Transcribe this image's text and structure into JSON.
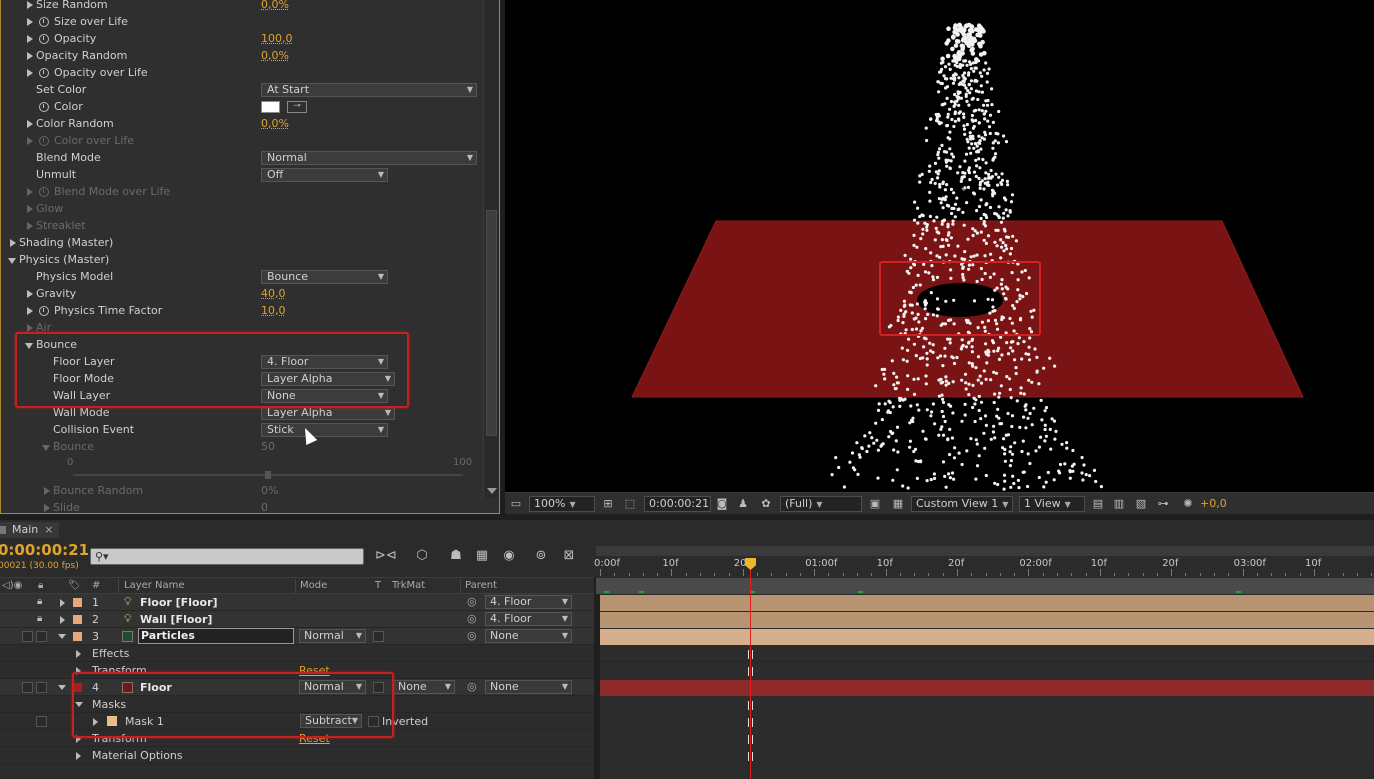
{
  "effect_controls": {
    "rows": [
      {
        "label": "Size Random",
        "value": "0,0%"
      },
      {
        "label": "Size over Life"
      },
      {
        "label": "Opacity",
        "value": "100,0"
      },
      {
        "label": "Opacity Random",
        "value": "0,0%"
      },
      {
        "label": "Opacity over Life"
      },
      {
        "label": "Set Color",
        "dropdown": "At Start"
      },
      {
        "label": "Color"
      },
      {
        "label": "Color Random",
        "value": "0,0%"
      },
      {
        "label": "Color over Life"
      },
      {
        "label": "Blend Mode",
        "dropdown": "Normal"
      },
      {
        "label": "Unmult",
        "dropdown": "Off"
      },
      {
        "label": "Blend Mode over Life"
      },
      {
        "label": "Glow"
      },
      {
        "label": "Streaklet"
      },
      {
        "label": "Shading (Master)"
      },
      {
        "label": "Physics (Master)"
      },
      {
        "label": "Physics Model",
        "dropdown": "Bounce"
      },
      {
        "label": "Gravity",
        "value": "40,0"
      },
      {
        "label": "Physics Time Factor",
        "value": "10,0"
      },
      {
        "label": "Air"
      },
      {
        "label": "Bounce"
      },
      {
        "label": "Floor Layer",
        "dropdown": "4. Floor"
      },
      {
        "label": "Floor Mode",
        "dropdown": "Layer Alpha"
      },
      {
        "label": "Wall Layer",
        "dropdown": "None"
      },
      {
        "label": "Wall Mode",
        "dropdown": "Layer Alpha"
      },
      {
        "label": "Collision Event",
        "dropdown": "Stick"
      },
      {
        "label": "Bounce",
        "value": "50"
      },
      {
        "label": "Bounce Random",
        "value": "0%"
      },
      {
        "label": "Slide",
        "value": "0"
      }
    ],
    "slider": {
      "min": "0",
      "max": "100"
    },
    "color_swatch": "#ffffff"
  },
  "viewer": {
    "zoom": "100%",
    "timecode": "0:00:00:21",
    "resolution": "(Full)",
    "view": "Custom View 1",
    "layout": "1 View",
    "exposure": "+0,0",
    "floor_color": "#7a1414"
  },
  "timeline": {
    "tab": "Main",
    "close": "×",
    "timecode": "0:00:00:21",
    "fps": "00021 (30.00 fps)",
    "search_placeholder": "⚲▾",
    "columns": {
      "num": "#",
      "layer_name": "Layer Name",
      "mode": "Mode",
      "t": "T",
      "trkmat": "TrkMat",
      "parent": "Parent"
    },
    "layers": [
      {
        "num": "1",
        "name": "Floor [Floor]",
        "parent": "4. Floor",
        "color": "#e8a87c"
      },
      {
        "num": "2",
        "name": "Wall [Floor]",
        "parent": "4. Floor",
        "color": "#e8a87c"
      },
      {
        "num": "3",
        "name": "Particles",
        "mode": "Normal",
        "parent": "None",
        "color": "#e8a87c"
      },
      {
        "num": "4",
        "name": "Floor",
        "mode": "Normal",
        "trkmat": "None",
        "parent": "None",
        "color": "#b01c1c"
      }
    ],
    "sub_rows": {
      "effects": "Effects",
      "transform": "Transform",
      "reset": "Reset",
      "masks": "Masks",
      "mask1": "Mask 1",
      "mask_mode": "Subtract",
      "inverted": "Inverted",
      "material": "Material Options"
    },
    "ruler_labels": [
      "0:00f",
      "10f",
      "20f",
      "01:00f",
      "10f",
      "20f",
      "02:00f",
      "10f",
      "20f",
      "03:00f",
      "10f"
    ]
  }
}
